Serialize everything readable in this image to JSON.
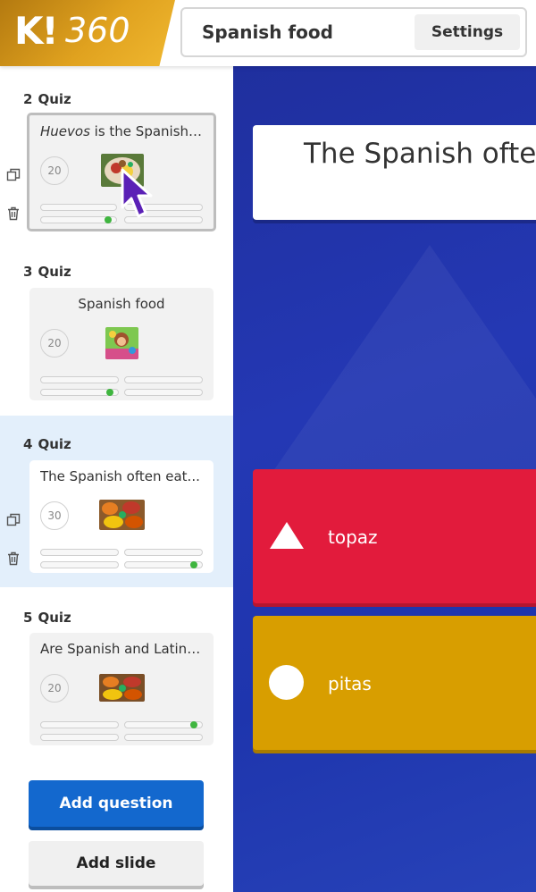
{
  "header": {
    "logo_k": "K!",
    "logo_360": "360",
    "title": "Spanish food",
    "settings_label": "Settings"
  },
  "sidebar": {
    "slides": [
      {
        "number": "2",
        "type": "Quiz",
        "question_italic": "Huevos",
        "question_rest": " is the Spanish word for...",
        "timer": "20",
        "thumb": "food-plate",
        "selected": true
      },
      {
        "number": "3",
        "type": "Quiz",
        "question": "Spanish food",
        "timer": "20",
        "thumb": "dora-cartoon"
      },
      {
        "number": "4",
        "type": "Quiz",
        "question": "The Spanish often eat...",
        "timer": "30",
        "thumb": "tapas-spread",
        "active": true
      },
      {
        "number": "5",
        "type": "Quiz",
        "question": "Are Spanish and Latin food the same?",
        "timer": "20",
        "thumb": "tapas-spread"
      }
    ],
    "add_question_label": "Add question",
    "add_slide_label": "Add slide"
  },
  "editor": {
    "question": "The Spanish often eat...",
    "answers": [
      {
        "shape": "triangle",
        "label": "topaz",
        "color": "#e21b3c"
      },
      {
        "shape": "circle",
        "label": "pitas",
        "color": "#d89e00"
      }
    ]
  },
  "colors": {
    "brand_gold": "#e0a21f",
    "canvas_blue": "#2438b4",
    "primary_button": "#1368ce",
    "correct_dot": "#3fb53f",
    "active_row": "#e3effb"
  }
}
